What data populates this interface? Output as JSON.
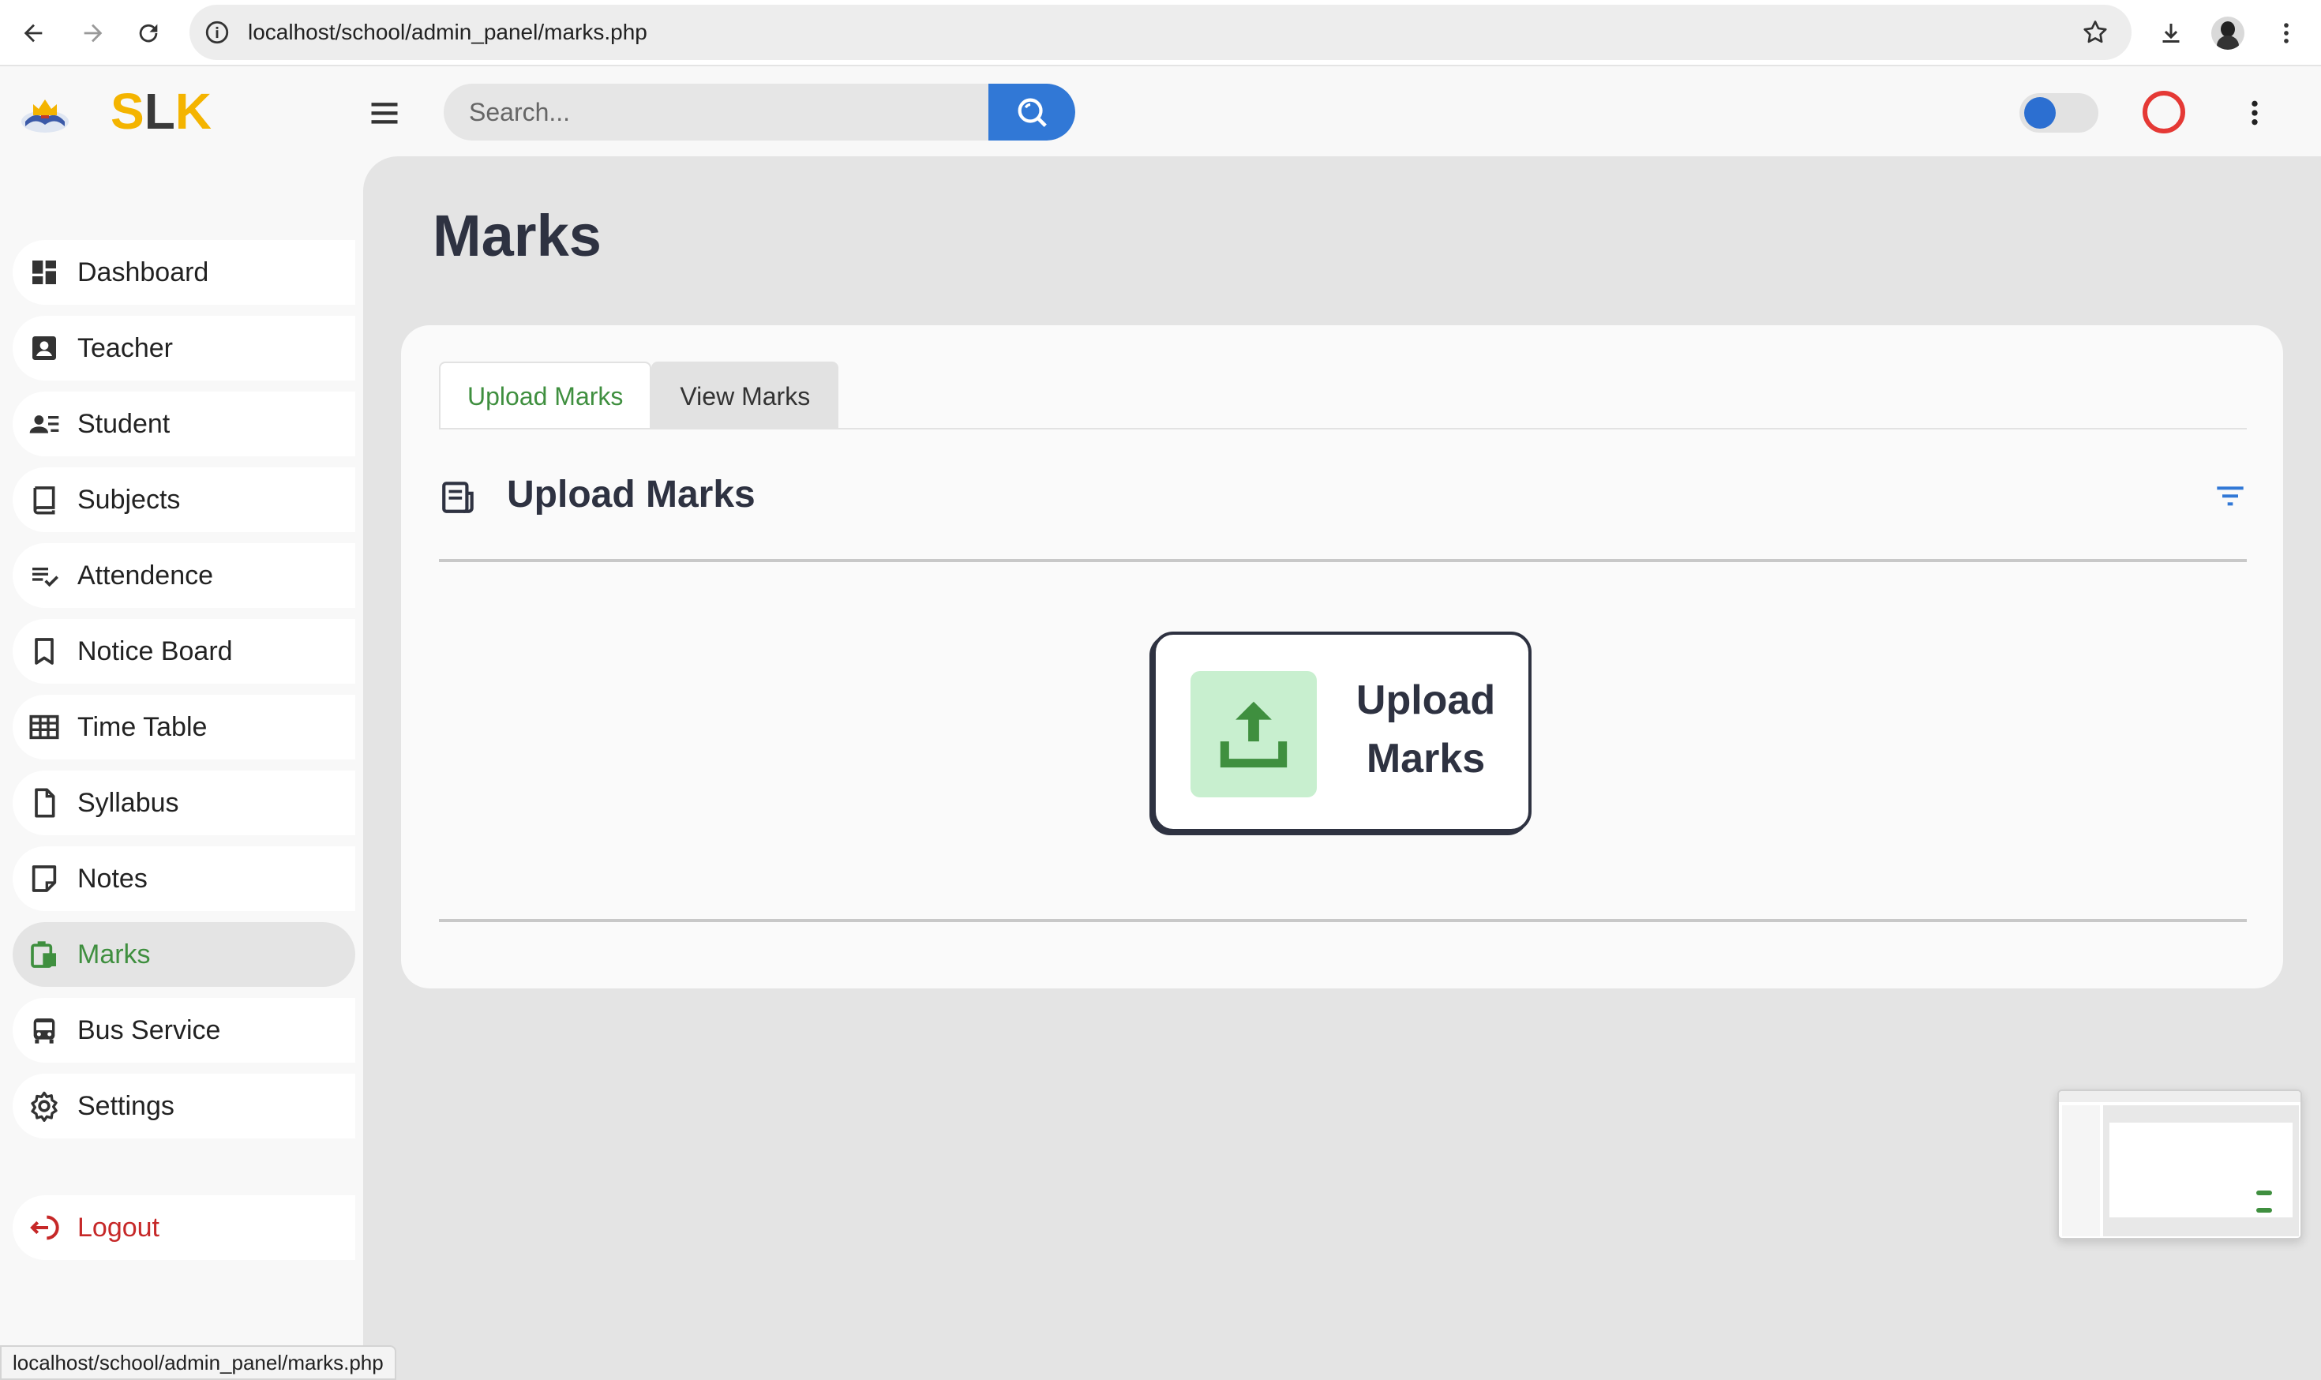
{
  "browser": {
    "url": "localhost/school/admin_panel/marks.php"
  },
  "brand": {
    "s": "S",
    "l": "L",
    "k": "K"
  },
  "search": {
    "placeholder": "Search..."
  },
  "sidebar": {
    "items": [
      {
        "label": "Dashboard",
        "icon": "dashboard-icon"
      },
      {
        "label": "Teacher",
        "icon": "teacher-icon"
      },
      {
        "label": "Student",
        "icon": "student-icon"
      },
      {
        "label": "Subjects",
        "icon": "book-icon"
      },
      {
        "label": "Attendence",
        "icon": "checklist-icon"
      },
      {
        "label": "Notice Board",
        "icon": "bookmark-icon"
      },
      {
        "label": "Time Table",
        "icon": "table-icon"
      },
      {
        "label": "Syllabus",
        "icon": "file-icon"
      },
      {
        "label": "Notes",
        "icon": "note-icon"
      },
      {
        "label": "Marks",
        "icon": "marks-icon",
        "active": true
      },
      {
        "label": "Bus Service",
        "icon": "bus-icon"
      },
      {
        "label": "Settings",
        "icon": "gear-icon"
      }
    ],
    "logout_label": "Logout"
  },
  "main": {
    "page_title": "Marks",
    "tabs": [
      {
        "label": "Upload Marks",
        "active": true
      },
      {
        "label": "View Marks",
        "active": false
      }
    ],
    "section_title": "Upload Marks",
    "upload_button": {
      "line1": "Upload",
      "line2": "Marks"
    }
  },
  "status_bar": {
    "url": "localhost/school/admin_panel/marks.php"
  },
  "colors": {
    "accent_green": "#3f8f3f",
    "accent_blue": "#3178d6",
    "brand_yellow": "#f4b400",
    "logout_red": "#c62828"
  }
}
